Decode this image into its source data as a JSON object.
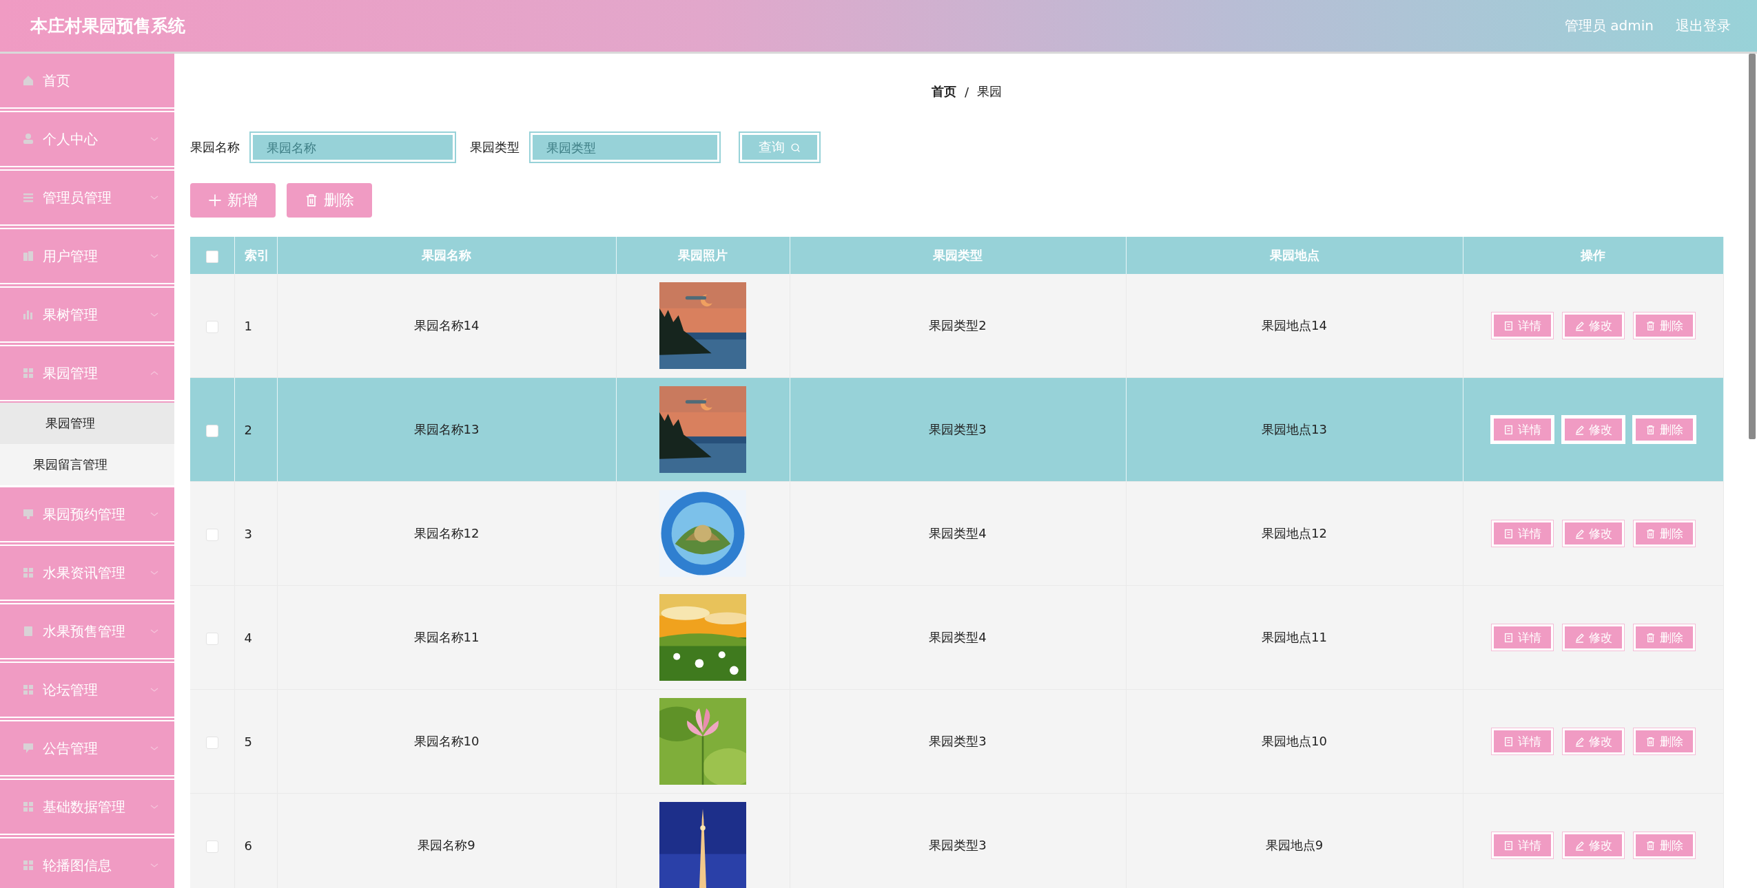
{
  "header": {
    "title": "本庄村果园预售系统",
    "user": "管理员 admin",
    "logout": "退出登录"
  },
  "sidebar": {
    "items": [
      {
        "label": "首页",
        "has_children": false
      },
      {
        "label": "个人中心",
        "expanded": false,
        "has_children": true
      },
      {
        "label": "管理员管理",
        "expanded": false,
        "has_children": true
      },
      {
        "label": "用户管理",
        "expanded": false,
        "has_children": true
      },
      {
        "label": "果树管理",
        "expanded": false,
        "has_children": true
      },
      {
        "label": "果园管理",
        "expanded": true,
        "has_children": true,
        "children": [
          {
            "label": "果园管理",
            "selected": true
          },
          {
            "label": "果园留言管理",
            "selected": false
          }
        ]
      },
      {
        "label": "果园预约管理",
        "expanded": false,
        "has_children": true
      },
      {
        "label": "水果资讯管理",
        "expanded": false,
        "has_children": true
      },
      {
        "label": "水果预售管理",
        "expanded": false,
        "has_children": true
      },
      {
        "label": "论坛管理",
        "expanded": false,
        "has_children": true
      },
      {
        "label": "公告管理",
        "expanded": false,
        "has_children": true
      },
      {
        "label": "基础数据管理",
        "expanded": false,
        "has_children": true
      },
      {
        "label": "轮播图信息",
        "expanded": false,
        "has_children": true
      }
    ]
  },
  "breadcrumb": {
    "items": [
      "首页",
      "果园"
    ],
    "separator": "/"
  },
  "search": {
    "fields": [
      {
        "label": "果园名称",
        "placeholder": "果园名称"
      },
      {
        "label": "果园类型",
        "placeholder": "果园类型"
      }
    ],
    "button": "查询"
  },
  "actions": [
    {
      "kind": "add",
      "label": "新增"
    },
    {
      "kind": "delete",
      "label": "删除"
    }
  ],
  "table": {
    "select_all": {
      "checked": false
    },
    "columns": [
      "索引",
      "果园名称",
      "果园照片",
      "果园类型",
      "果园地点",
      "操作"
    ],
    "rows": [
      {
        "index": "1",
        "name": "果园名称14",
        "type": "果园类型2",
        "location": "果园地点14",
        "selected": false,
        "checked": false,
        "buttons": [
          {
            "kind": "detail",
            "label": "详情"
          },
          {
            "kind": "edit",
            "label": "修改"
          },
          {
            "kind": "delete",
            "label": "删除"
          }
        ]
      },
      {
        "index": "2",
        "name": "果园名称13",
        "type": "果园类型3",
        "location": "果园地点13",
        "selected": true,
        "checked": false,
        "buttons": [
          {
            "kind": "detail",
            "label": "详情"
          },
          {
            "kind": "edit",
            "label": "修改"
          },
          {
            "kind": "delete",
            "label": "删除"
          }
        ]
      },
      {
        "index": "3",
        "name": "果园名称12",
        "type": "果园类型4",
        "location": "果园地点12",
        "selected": false,
        "checked": false,
        "buttons": [
          {
            "kind": "detail",
            "label": "详情"
          },
          {
            "kind": "edit",
            "label": "修改"
          },
          {
            "kind": "delete",
            "label": "删除"
          }
        ]
      },
      {
        "index": "4",
        "name": "果园名称11",
        "type": "果园类型4",
        "location": "果园地点11",
        "selected": false,
        "checked": false,
        "buttons": [
          {
            "kind": "detail",
            "label": "详情"
          },
          {
            "kind": "edit",
            "label": "修改"
          },
          {
            "kind": "delete",
            "label": "删除"
          }
        ]
      },
      {
        "index": "5",
        "name": "果园名称10",
        "type": "果园类型3",
        "location": "果园地点10",
        "selected": false,
        "checked": false,
        "buttons": [
          {
            "kind": "detail",
            "label": "详情"
          },
          {
            "kind": "edit",
            "label": "修改"
          },
          {
            "kind": "delete",
            "label": "删除"
          }
        ]
      },
      {
        "index": "6",
        "name": "果园名称9",
        "type": "果园类型3",
        "location": "果园地点9",
        "selected": false,
        "checked": false,
        "buttons": [
          {
            "kind": "detail",
            "label": "详情"
          },
          {
            "kind": "edit",
            "label": "修改"
          },
          {
            "kind": "delete",
            "label": "删除"
          }
        ]
      }
    ]
  }
}
